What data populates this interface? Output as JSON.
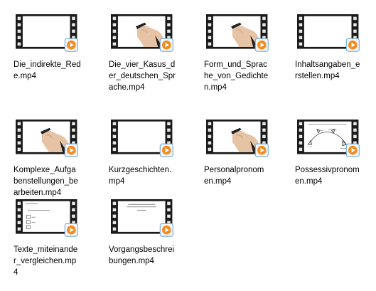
{
  "files": [
    {
      "name": "Die_indirekte_Rede.mp4",
      "label": "Die_indirekte_Rede.mp4",
      "thumb": "blank"
    },
    {
      "name": "Die_vier_Kasus_der_deutschen_Sprache.mp4",
      "label": "Die_vier_Kasus_der_deutschen_Sprache.mp4",
      "thumb": "hand"
    },
    {
      "name": "Form_und_Sprache_von_Gedichten.mp4",
      "label": "Form_und_Sprache_von_Gedichten.mp4",
      "thumb": "hand"
    },
    {
      "name": "Inhaltsangaben_erstellen.mp4",
      "label": "Inhaltsangaben_erstellen.mp4",
      "thumb": "blank"
    },
    {
      "name": "Komplexe_Aufgabenstellungen_bearbeiten.mp4",
      "label": "Komplexe_Aufgabenstellungen_bearbeiten.mp4",
      "thumb": "hand"
    },
    {
      "name": "Kurzgeschichten.mp4",
      "label": "Kurzgeschichten.mp4",
      "thumb": "blank"
    },
    {
      "name": "Personalpronomen.mp4",
      "label": "Personalpronomen.mp4",
      "thumb": "hand"
    },
    {
      "name": "Possessivpronomen.mp4",
      "label": "Possessivpronomen.mp4",
      "thumb": "diagram"
    },
    {
      "name": "Texte_miteinander_vergleichen.mp4",
      "label": "Texte_miteinander_vergleichen.mp4",
      "thumb": "list"
    },
    {
      "name": "Vorgangsbeschreibungen.mp4",
      "label": "Vorgangsbeschreibungen.mp4",
      "thumb": "title"
    }
  ],
  "colors": {
    "badge": "#f28c1e",
    "badge_frame": "#6fa8dc",
    "film": "#1a1a1a"
  }
}
